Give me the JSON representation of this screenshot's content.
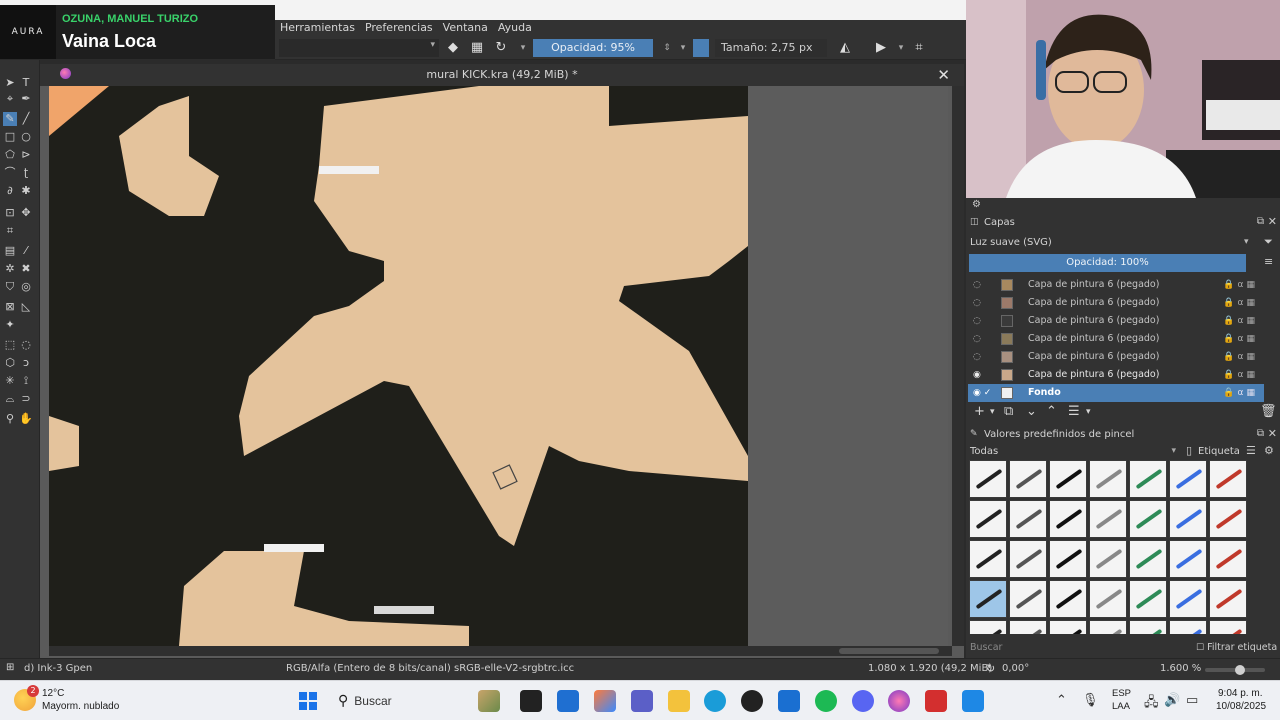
{
  "now_playing": {
    "logo": "AURA",
    "artist": "OZUNA, MANUEL TURIZO",
    "title": "Vaina Loca"
  },
  "menu": [
    "Herramientas",
    "Preferencias",
    "Ventana",
    "Ayuda"
  ],
  "tool_options": {
    "opacity_label": "Opacidad: 95%",
    "size_label": "Tamaño: 2,75 px"
  },
  "document": {
    "title": "mural KICK.kra (49,2 MiB) *"
  },
  "status": {
    "brush": "d) Ink-3 Gpen",
    "color_profile": "RGB/Alfa (Entero de 8 bits/canal)  sRGB-elle-V2-srgbtrc.icc",
    "dimensions": "1.080 x 1.920 (49,2 MiB)",
    "rotation": "0,00°",
    "zoom": "1.600 %"
  },
  "layers_docker": {
    "title": "Capas",
    "blend_mode": "Luz suave (SVG)",
    "opacity": "Opacidad:  100%",
    "layers": [
      {
        "name": "Capa de pintura 6 (pegado)",
        "visible": false,
        "selected": false
      },
      {
        "name": "Capa de pintura 6 (pegado)",
        "visible": false,
        "selected": false
      },
      {
        "name": "Capa de pintura 6 (pegado)",
        "visible": false,
        "selected": false
      },
      {
        "name": "Capa de pintura 6 (pegado)",
        "visible": false,
        "selected": false
      },
      {
        "name": "Capa de pintura 6 (pegado)",
        "visible": false,
        "selected": false
      },
      {
        "name": "Capa de pintura 6 (pegado)",
        "visible": true,
        "selected": false
      },
      {
        "name": "Fondo",
        "visible": true,
        "selected": true
      }
    ]
  },
  "brush_presets": {
    "title": "Valores predefinidos de pincel",
    "filter": "Todas",
    "tag_label": "Etiqueta",
    "search_placeholder": "Buscar",
    "filter_tag_label": "Filtrar etiqueta",
    "selected_index": 21
  },
  "taskbar": {
    "weather_badge": "2",
    "weather_temp": "12°C",
    "weather_desc": "Mayorm. nublado",
    "search_label": "Buscar",
    "lang1": "ESP",
    "lang2": "LAA",
    "time": "9:04 p. m.",
    "date": "10/08/2025"
  },
  "colors": {
    "skin": "#e4c39c",
    "ink": "#1f1f1a",
    "accent": "#4a7fb5",
    "ui_bg": "#323232",
    "spotify_green": "#39d26a"
  }
}
